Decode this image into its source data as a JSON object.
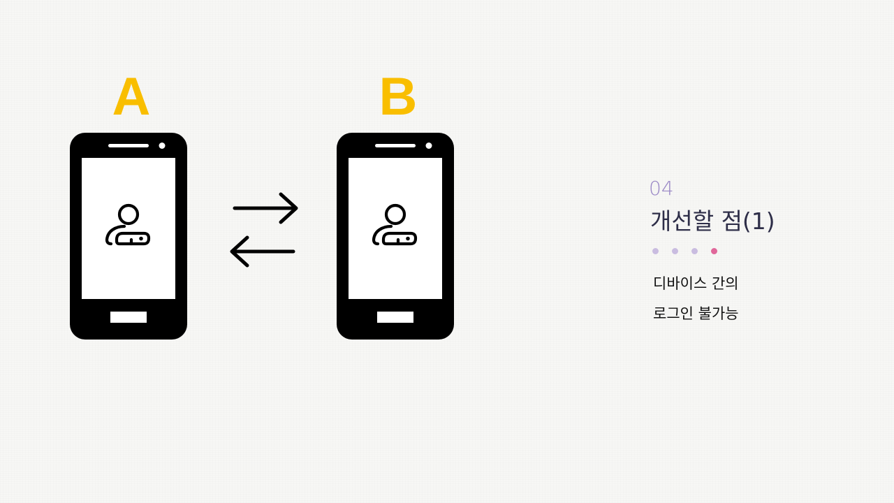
{
  "devices": [
    {
      "label": "A",
      "icon": "smartphone-icon",
      "screen_icon": "user-key-icon"
    },
    {
      "label": "B",
      "icon": "smartphone-icon",
      "screen_icon": "user-key-icon"
    }
  ],
  "connector_icon": "exchange-arrows-icon",
  "section": {
    "number": "04",
    "title": "개선할 점(1)"
  },
  "progress": {
    "total": 4,
    "current": 4
  },
  "description": {
    "line1": "디바이스 간의",
    "line2": "로그인 불가능"
  },
  "colors": {
    "label": "#f9be00",
    "phone": "#000000",
    "section_number": "#9a88c6",
    "dot_inactive": "#c9bce0",
    "dot_active": "#e0679a"
  }
}
